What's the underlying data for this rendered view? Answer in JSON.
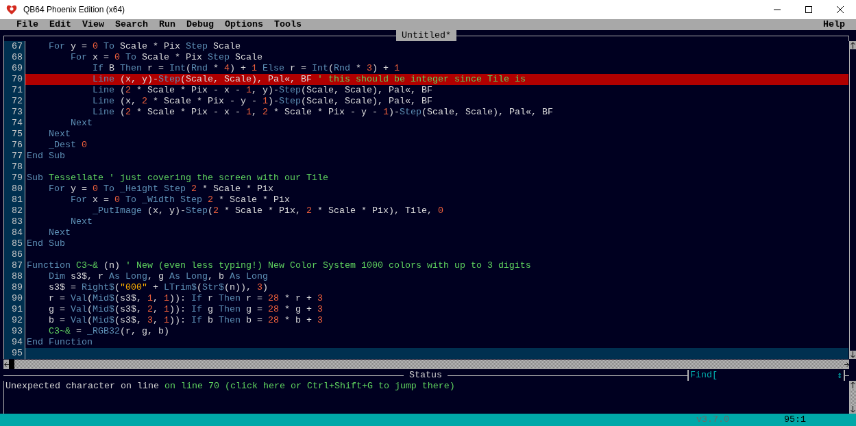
{
  "window": {
    "title": "QB64 Phoenix Edition (x64)"
  },
  "menu": {
    "items": [
      "File",
      "Edit",
      "View",
      "Search",
      "Run",
      "Debug",
      "Options",
      "Tools"
    ],
    "help": "Help"
  },
  "editor": {
    "tab": "Untitled*",
    "lines": [
      {
        "number": "67",
        "error": false,
        "current": false,
        "tokens": [
          {
            "text": "    For",
            "kind": "keyword"
          },
          {
            "text": " y = ",
            "kind": "plain"
          },
          {
            "text": "0",
            "kind": "number"
          },
          {
            "text": " To",
            "kind": "keyword"
          },
          {
            "text": " Scale * Pix ",
            "kind": "plain"
          },
          {
            "text": "Step",
            "kind": "keyword"
          },
          {
            "text": " Scale",
            "kind": "plain"
          }
        ]
      },
      {
        "number": "68",
        "error": false,
        "current": false,
        "tokens": [
          {
            "text": "        For",
            "kind": "keyword"
          },
          {
            "text": " x = ",
            "kind": "plain"
          },
          {
            "text": "0",
            "kind": "number"
          },
          {
            "text": " To",
            "kind": "keyword"
          },
          {
            "text": " Scale * Pix ",
            "kind": "plain"
          },
          {
            "text": "Step",
            "kind": "keyword"
          },
          {
            "text": " Scale",
            "kind": "plain"
          }
        ]
      },
      {
        "number": "69",
        "error": false,
        "current": false,
        "tokens": [
          {
            "text": "            If",
            "kind": "keyword"
          },
          {
            "text": " B ",
            "kind": "plain"
          },
          {
            "text": "Then",
            "kind": "keyword"
          },
          {
            "text": " r = ",
            "kind": "plain"
          },
          {
            "text": "Int",
            "kind": "keyword"
          },
          {
            "text": "(",
            "kind": "plain"
          },
          {
            "text": "Rnd",
            "kind": "keyword"
          },
          {
            "text": " * ",
            "kind": "plain"
          },
          {
            "text": "4",
            "kind": "number"
          },
          {
            "text": ") + ",
            "kind": "plain"
          },
          {
            "text": "1",
            "kind": "number"
          },
          {
            "text": " Else",
            "kind": "keyword"
          },
          {
            "text": " r = ",
            "kind": "plain"
          },
          {
            "text": "Int",
            "kind": "keyword"
          },
          {
            "text": "(",
            "kind": "plain"
          },
          {
            "text": "Rnd",
            "kind": "keyword"
          },
          {
            "text": " * ",
            "kind": "plain"
          },
          {
            "text": "3",
            "kind": "number"
          },
          {
            "text": ") + ",
            "kind": "plain"
          },
          {
            "text": "1",
            "kind": "number"
          }
        ]
      },
      {
        "number": "70",
        "error": true,
        "current": false,
        "tokens": [
          {
            "text": "            Line",
            "kind": "keyword"
          },
          {
            "text": " (x, y)-",
            "kind": "plain"
          },
          {
            "text": "Step",
            "kind": "keyword"
          },
          {
            "text": "(Scale, Scale), Pal«, BF ",
            "kind": "plain"
          },
          {
            "text": "' this should be integer since Tile is",
            "kind": "comment"
          }
        ]
      },
      {
        "number": "71",
        "error": false,
        "current": false,
        "tokens": [
          {
            "text": "            Line",
            "kind": "keyword"
          },
          {
            "text": " (",
            "kind": "plain"
          },
          {
            "text": "2",
            "kind": "number"
          },
          {
            "text": " * Scale * Pix - x - ",
            "kind": "plain"
          },
          {
            "text": "1",
            "kind": "number"
          },
          {
            "text": ", y)-",
            "kind": "plain"
          },
          {
            "text": "Step",
            "kind": "keyword"
          },
          {
            "text": "(Scale, Scale), Pal«, BF",
            "kind": "plain"
          }
        ]
      },
      {
        "number": "72",
        "error": false,
        "current": false,
        "tokens": [
          {
            "text": "            Line",
            "kind": "keyword"
          },
          {
            "text": " (x, ",
            "kind": "plain"
          },
          {
            "text": "2",
            "kind": "number"
          },
          {
            "text": " * Scale * Pix - y - ",
            "kind": "plain"
          },
          {
            "text": "1",
            "kind": "number"
          },
          {
            "text": ")-",
            "kind": "plain"
          },
          {
            "text": "Step",
            "kind": "keyword"
          },
          {
            "text": "(Scale, Scale), Pal«, BF",
            "kind": "plain"
          }
        ]
      },
      {
        "number": "73",
        "error": false,
        "current": false,
        "tokens": [
          {
            "text": "            Line",
            "kind": "keyword"
          },
          {
            "text": " (",
            "kind": "plain"
          },
          {
            "text": "2",
            "kind": "number"
          },
          {
            "text": " * Scale * Pix - x - ",
            "kind": "plain"
          },
          {
            "text": "1",
            "kind": "number"
          },
          {
            "text": ", ",
            "kind": "plain"
          },
          {
            "text": "2",
            "kind": "number"
          },
          {
            "text": " * Scale * Pix - y - ",
            "kind": "plain"
          },
          {
            "text": "1",
            "kind": "number"
          },
          {
            "text": ")-",
            "kind": "plain"
          },
          {
            "text": "Step",
            "kind": "keyword"
          },
          {
            "text": "(Scale, Scale), Pal«, BF",
            "kind": "plain"
          }
        ]
      },
      {
        "number": "74",
        "error": false,
        "current": false,
        "tokens": [
          {
            "text": "        Next",
            "kind": "keyword"
          }
        ]
      },
      {
        "number": "75",
        "error": false,
        "current": false,
        "tokens": [
          {
            "text": "    Next",
            "kind": "keyword"
          }
        ]
      },
      {
        "number": "76",
        "error": false,
        "current": false,
        "tokens": [
          {
            "text": "    _Dest",
            "kind": "keyword"
          },
          {
            "text": " 0",
            "kind": "number"
          }
        ]
      },
      {
        "number": "77",
        "error": false,
        "current": false,
        "tokens": [
          {
            "text": "End Sub",
            "kind": "keyword"
          }
        ]
      },
      {
        "number": "78",
        "error": false,
        "current": false
      },
      {
        "number": "79",
        "error": false,
        "current": false,
        "tokens": [
          {
            "text": "Sub",
            "kind": "keyword"
          },
          {
            "text": " Tessellate",
            "kind": "name"
          },
          {
            "text": " ' just covering the screen with our Tile",
            "kind": "comment"
          }
        ]
      },
      {
        "number": "80",
        "error": false,
        "current": false,
        "tokens": [
          {
            "text": "    For",
            "kind": "keyword"
          },
          {
            "text": " y = ",
            "kind": "plain"
          },
          {
            "text": "0",
            "kind": "number"
          },
          {
            "text": " To _Height Step",
            "kind": "keyword"
          },
          {
            "text": " 2",
            "kind": "number"
          },
          {
            "text": " * Scale * Pix",
            "kind": "plain"
          }
        ]
      },
      {
        "number": "81",
        "error": false,
        "current": false,
        "tokens": [
          {
            "text": "        For",
            "kind": "keyword"
          },
          {
            "text": " x = ",
            "kind": "plain"
          },
          {
            "text": "0",
            "kind": "number"
          },
          {
            "text": " To _Width Step",
            "kind": "keyword"
          },
          {
            "text": " 2",
            "kind": "number"
          },
          {
            "text": " * Scale * Pix",
            "kind": "plain"
          }
        ]
      },
      {
        "number": "82",
        "error": false,
        "current": false,
        "tokens": [
          {
            "text": "            _PutImage",
            "kind": "keyword"
          },
          {
            "text": " (x, y)-",
            "kind": "plain"
          },
          {
            "text": "Step",
            "kind": "keyword"
          },
          {
            "text": "(",
            "kind": "plain"
          },
          {
            "text": "2",
            "kind": "number"
          },
          {
            "text": " * Scale * Pix, ",
            "kind": "plain"
          },
          {
            "text": "2",
            "kind": "number"
          },
          {
            "text": " * Scale * Pix), Tile, ",
            "kind": "plain"
          },
          {
            "text": "0",
            "kind": "number"
          }
        ]
      },
      {
        "number": "83",
        "error": false,
        "current": false,
        "tokens": [
          {
            "text": "        Next",
            "kind": "keyword"
          }
        ]
      },
      {
        "number": "84",
        "error": false,
        "current": false,
        "tokens": [
          {
            "text": "    Next",
            "kind": "keyword"
          }
        ]
      },
      {
        "number": "85",
        "error": false,
        "current": false,
        "tokens": [
          {
            "text": "End Sub",
            "kind": "keyword"
          }
        ]
      },
      {
        "number": "86",
        "error": false,
        "current": false
      },
      {
        "number": "87",
        "error": false,
        "current": false,
        "tokens": [
          {
            "text": "Function",
            "kind": "keyword"
          },
          {
            "text": " C3~&",
            "kind": "name"
          },
          {
            "text": " (n) ",
            "kind": "plain"
          },
          {
            "text": "' New (even less typing!) New Color System 1000 colors with up to 3 digits",
            "kind": "comment"
          }
        ]
      },
      {
        "number": "88",
        "error": false,
        "current": false,
        "tokens": [
          {
            "text": "    Dim",
            "kind": "keyword"
          },
          {
            "text": " s3$, r ",
            "kind": "plain"
          },
          {
            "text": "As Long",
            "kind": "keyword"
          },
          {
            "text": ", g ",
            "kind": "plain"
          },
          {
            "text": "As Long",
            "kind": "keyword"
          },
          {
            "text": ", b ",
            "kind": "plain"
          },
          {
            "text": "As Long",
            "kind": "keyword"
          }
        ]
      },
      {
        "number": "89",
        "error": false,
        "current": false,
        "tokens": [
          {
            "text": "    s3$ = ",
            "kind": "plain"
          },
          {
            "text": "Right$",
            "kind": "keyword"
          },
          {
            "text": "(",
            "kind": "plain"
          },
          {
            "text": "\"000\"",
            "kind": "string"
          },
          {
            "text": " + ",
            "kind": "plain"
          },
          {
            "text": "LTrim$",
            "kind": "keyword"
          },
          {
            "text": "(",
            "kind": "plain"
          },
          {
            "text": "Str$",
            "kind": "keyword"
          },
          {
            "text": "(n)), ",
            "kind": "plain"
          },
          {
            "text": "3",
            "kind": "number"
          },
          {
            "text": ")",
            "kind": "plain"
          }
        ]
      },
      {
        "number": "90",
        "error": false,
        "current": false,
        "tokens": [
          {
            "text": "    r = ",
            "kind": "plain"
          },
          {
            "text": "Val",
            "kind": "keyword"
          },
          {
            "text": "(",
            "kind": "plain"
          },
          {
            "text": "Mid$",
            "kind": "keyword"
          },
          {
            "text": "(s3$, ",
            "kind": "plain"
          },
          {
            "text": "1",
            "kind": "number"
          },
          {
            "text": ", ",
            "kind": "plain"
          },
          {
            "text": "1",
            "kind": "number"
          },
          {
            "text": ")): ",
            "kind": "plain"
          },
          {
            "text": "If",
            "kind": "keyword"
          },
          {
            "text": " r ",
            "kind": "plain"
          },
          {
            "text": "Then",
            "kind": "keyword"
          },
          {
            "text": " r = ",
            "kind": "plain"
          },
          {
            "text": "28",
            "kind": "number"
          },
          {
            "text": " * r + ",
            "kind": "plain"
          },
          {
            "text": "3",
            "kind": "number"
          }
        ]
      },
      {
        "number": "91",
        "error": false,
        "current": false,
        "tokens": [
          {
            "text": "    g = ",
            "kind": "plain"
          },
          {
            "text": "Val",
            "kind": "keyword"
          },
          {
            "text": "(",
            "kind": "plain"
          },
          {
            "text": "Mid$",
            "kind": "keyword"
          },
          {
            "text": "(s3$, ",
            "kind": "plain"
          },
          {
            "text": "2",
            "kind": "number"
          },
          {
            "text": ", ",
            "kind": "plain"
          },
          {
            "text": "1",
            "kind": "number"
          },
          {
            "text": ")): ",
            "kind": "plain"
          },
          {
            "text": "If",
            "kind": "keyword"
          },
          {
            "text": " g ",
            "kind": "plain"
          },
          {
            "text": "Then",
            "kind": "keyword"
          },
          {
            "text": " g = ",
            "kind": "plain"
          },
          {
            "text": "28",
            "kind": "number"
          },
          {
            "text": " * g + ",
            "kind": "plain"
          },
          {
            "text": "3",
            "kind": "number"
          }
        ]
      },
      {
        "number": "92",
        "error": false,
        "current": false,
        "tokens": [
          {
            "text": "    b = ",
            "kind": "plain"
          },
          {
            "text": "Val",
            "kind": "keyword"
          },
          {
            "text": "(",
            "kind": "plain"
          },
          {
            "text": "Mid$",
            "kind": "keyword"
          },
          {
            "text": "(s3$, ",
            "kind": "plain"
          },
          {
            "text": "3",
            "kind": "number"
          },
          {
            "text": ", ",
            "kind": "plain"
          },
          {
            "text": "1",
            "kind": "number"
          },
          {
            "text": ")): ",
            "kind": "plain"
          },
          {
            "text": "If",
            "kind": "keyword"
          },
          {
            "text": " b ",
            "kind": "plain"
          },
          {
            "text": "Then",
            "kind": "keyword"
          },
          {
            "text": " b = ",
            "kind": "plain"
          },
          {
            "text": "28",
            "kind": "number"
          },
          {
            "text": " * b + ",
            "kind": "plain"
          },
          {
            "text": "3",
            "kind": "number"
          }
        ]
      },
      {
        "number": "93",
        "error": false,
        "current": false,
        "tokens": [
          {
            "text": "    C3~&",
            "kind": "name"
          },
          {
            "text": " = ",
            "kind": "plain"
          },
          {
            "text": "_RGB32",
            "kind": "keyword"
          },
          {
            "text": "(r, g, b)",
            "kind": "plain"
          }
        ]
      },
      {
        "number": "94",
        "error": false,
        "current": false,
        "tokens": [
          {
            "text": "End Function",
            "kind": "keyword"
          }
        ]
      },
      {
        "number": "95",
        "error": false,
        "current": true
      }
    ]
  },
  "status": {
    "title": "Status",
    "message": "Unexpected character on line ",
    "link": "on line 70 (click here or Ctrl+Shift+G to jump there)",
    "find_label": "Find[",
    "find_toggle": "↕"
  },
  "bottom_bar": {
    "version": "v3.7.0",
    "position": "95:1"
  }
}
